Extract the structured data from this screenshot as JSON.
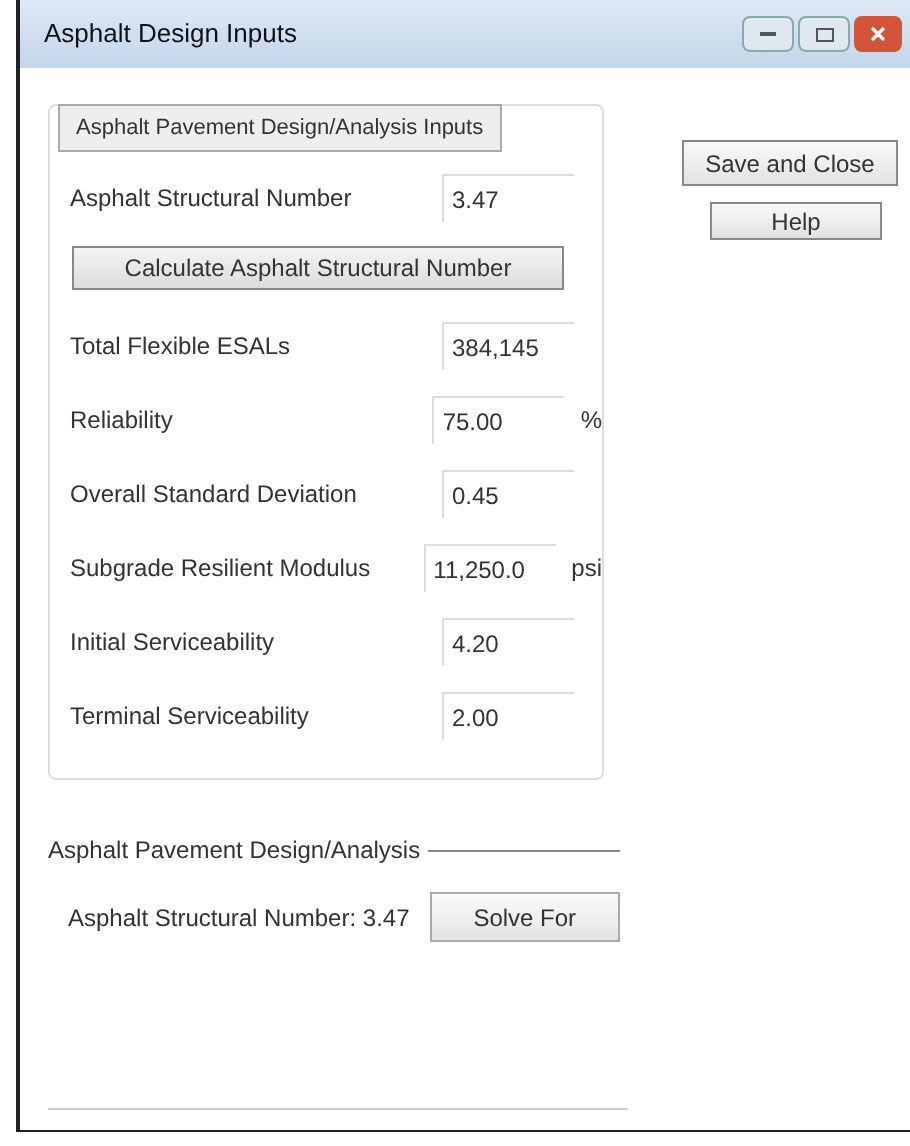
{
  "window": {
    "title": "Asphalt Design Inputs"
  },
  "inputs_group": {
    "title": "Asphalt Pavement Design/Analysis Inputs",
    "structural_number": {
      "label": "Asphalt Structural Number",
      "value": "3.47"
    },
    "calculate_button": "Calculate Asphalt Structural Number",
    "fields": [
      {
        "label": "Total Flexible ESALs",
        "value": "384,145"
      },
      {
        "label": "Reliability",
        "value": "75.00",
        "unit": "%"
      },
      {
        "label": "Overall Standard Deviation",
        "value": "0.45"
      },
      {
        "label": "Subgrade Resilient Modulus",
        "value": "11,250.0",
        "unit": "psi"
      },
      {
        "label": "Initial Serviceability",
        "value": "4.20"
      },
      {
        "label": "Terminal Serviceability",
        "value": "2.00"
      }
    ]
  },
  "buttons": [
    "Save and Close",
    "Help"
  ],
  "analysis_group": {
    "title": "Asphalt Pavement Design/Analysis",
    "result": "Asphalt Structural Number: 3.47",
    "solve_button": "Solve For"
  }
}
